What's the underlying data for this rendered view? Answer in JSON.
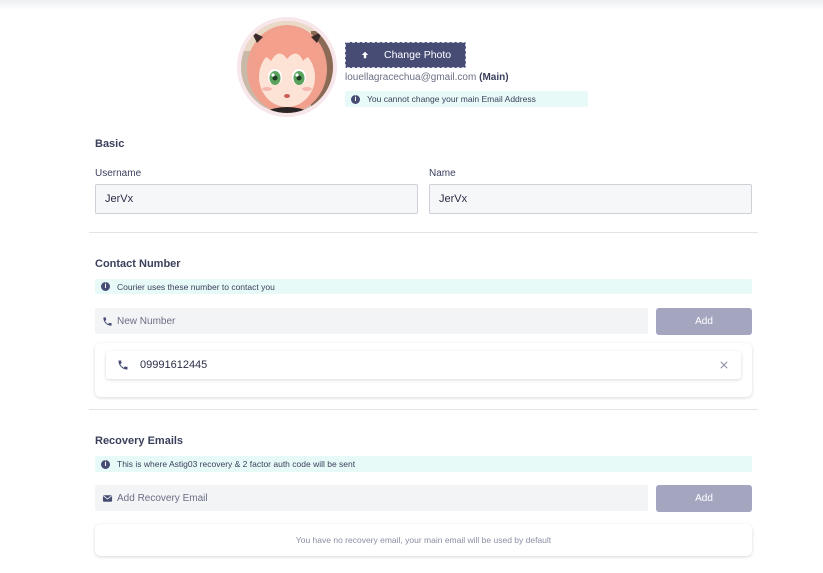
{
  "profile": {
    "change_photo_label": "Change Photo",
    "email": "louellagracechua@gmail.com",
    "email_tag": "(Main)",
    "email_notice": "You cannot change your main Email Address"
  },
  "basic": {
    "title": "Basic",
    "username_label": "Username",
    "username_value": "JerVx",
    "name_label": "Name",
    "name_value": "JerVx"
  },
  "contact": {
    "title": "Contact Number",
    "notice": "Courier uses these number to contact you",
    "input_placeholder": "New Number",
    "add_label": "Add",
    "numbers": [
      "09991612445"
    ]
  },
  "recovery": {
    "title": "Recovery Emails",
    "notice": "This is where Astig03 recovery & 2 factor auth code will be sent",
    "input_placeholder": "Add Recovery Email",
    "add_label": "Add",
    "empty_message": "You have no recovery email, your main email will be used by default"
  },
  "icons": {
    "upload": "upload-arrow-icon",
    "info": "info-icon",
    "phone": "phone-icon",
    "mail": "mail-icon",
    "close": "close-icon"
  },
  "colors": {
    "primary": "#474c75",
    "button_disabled": "#a4a6c0",
    "notice_bg": "#e8faf7",
    "input_bg": "#f3f4f6"
  }
}
